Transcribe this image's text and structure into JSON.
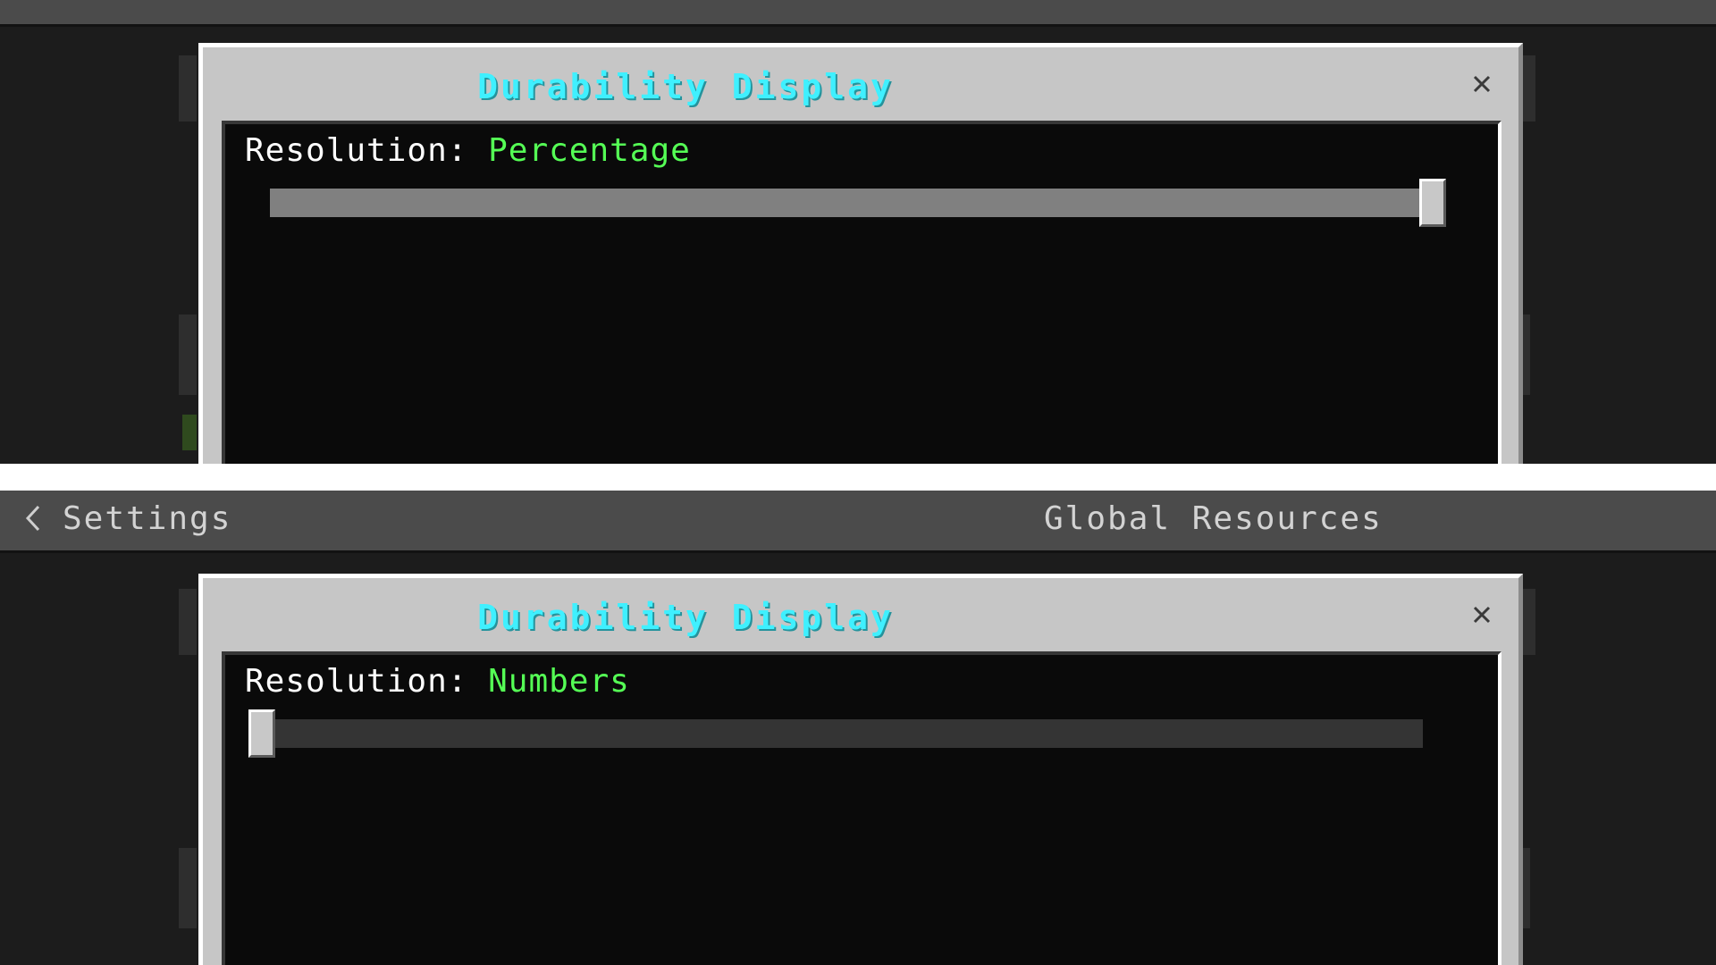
{
  "nav": {
    "back_label": "Settings",
    "title": "Global Resources"
  },
  "dialogs": [
    {
      "title": "Durability Display",
      "resolution_label": "Resolution:",
      "resolution_value": "Percentage",
      "slider_fraction": 1.0
    },
    {
      "title": "Durability Display",
      "resolution_label": "Resolution:",
      "resolution_value": "Numbers",
      "slider_fraction": 0.0
    }
  ],
  "colors": {
    "title": "#3ff0ff",
    "value": "#55ff55",
    "panel": "#c6c6c6",
    "content": "#0a0a0a"
  }
}
